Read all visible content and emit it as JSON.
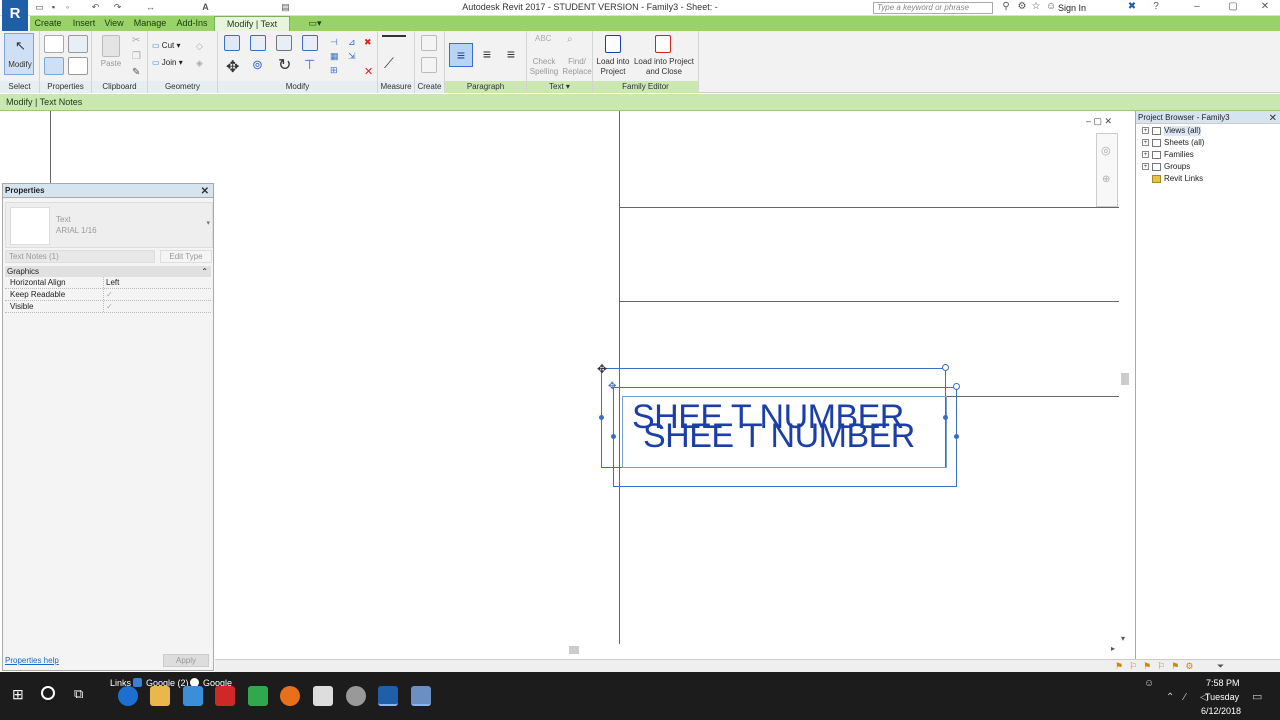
{
  "title": "Autodesk Revit 2017 - STUDENT VERSION -     Family3 - Sheet: -",
  "app_button": "R",
  "search_placeholder": "Type a keyword or phrase",
  "sign_in": "Sign In",
  "tabs": [
    "Create",
    "Insert",
    "View",
    "Manage",
    "Add-Ins",
    "Modify | Text Notes"
  ],
  "ribbon": {
    "panels": [
      "Select",
      "Properties",
      "Clipboard",
      "Geometry",
      "Modify",
      "Measure",
      "Create",
      "Paragraph",
      "Text",
      "Family Editor"
    ],
    "modify_btn": "Modify",
    "cut": "Cut",
    "join": "Join",
    "paste": "Paste",
    "check_spelling": "Check Spelling",
    "find_replace": "Find/ Replace",
    "load_project": "Load into Project",
    "load_close": "Load into Project and Close"
  },
  "options_bar": "Modify | Text Notes",
  "properties": {
    "title": "Properties",
    "type_name": "Text",
    "type_sub": "ARIAL 1/16",
    "filter": "Text Notes (1)",
    "edit_type": "Edit Type",
    "group": "Graphics",
    "rows": [
      {
        "k": "Horizontal Align",
        "v": "Left"
      },
      {
        "k": "Keep Readable",
        "v": "✓"
      },
      {
        "k": "Visible",
        "v": "✓"
      }
    ],
    "help": "Properties help",
    "apply": "Apply"
  },
  "canvas": {
    "text1": "SHEE T NUMBER",
    "text2": "SHEE T NUMBER"
  },
  "browser": {
    "title": "Project Browser - Family3",
    "items": [
      "Views (all)",
      "Sheets (all)",
      "Families",
      "Groups",
      "Revit Links"
    ]
  },
  "taskbar": {
    "links": "Links",
    "google2": "Google (2)",
    "google": "Google",
    "time": "7:58 PM",
    "day": "Tuesday",
    "date": "6/12/2018"
  },
  "colors": {
    "accent": "#9ad26a",
    "note_blue": "#1b3ea8",
    "selection": "#3a6fc4"
  }
}
